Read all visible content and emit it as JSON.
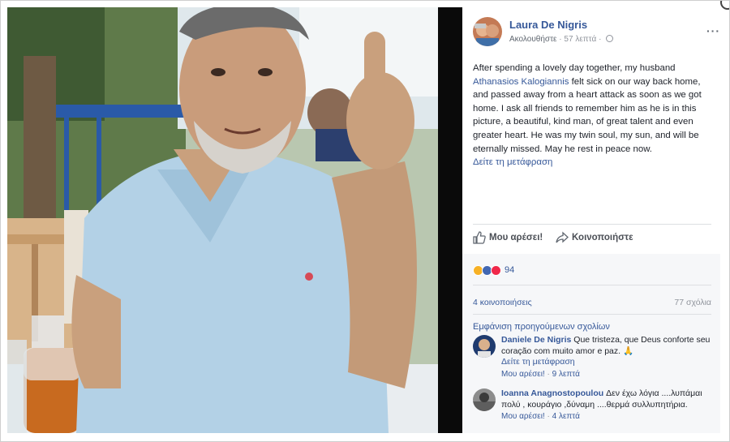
{
  "post": {
    "author": "Laura De Nigris",
    "follow_label": "Ακολουθήστε",
    "dot": "·",
    "time": "57 λεπτά",
    "more_label": "···",
    "text_before": "After spending a lovely day together, my husband",
    "mention": "Athanasios Kalogiannis",
    "text_after": "felt sick on our way back home, and passed away from a heart attack as soon as we got home. I ask all friends to remember him as he is in this picture, a beautiful, kind man, of great talent and even greater heart. He was my twin soul, my sun, and will be eternally missed. May he rest in peace now.",
    "see_translation": "Δείτε τη μετάφραση"
  },
  "actions": {
    "like": "Μου αρέσει!",
    "share": "Κοινοποιήστε"
  },
  "reactions": {
    "count": "94",
    "icons": [
      "sad-reaction-icon",
      "like-reaction-icon",
      "love-reaction-icon"
    ]
  },
  "stats": {
    "shares": "4 κοινοποιήσεις",
    "comments": "77 σχόλια"
  },
  "previous_comments": "Εμφάνιση προηγούμενων σχολίων",
  "comments": [
    {
      "name": "Daniele De Nigris",
      "text": "Que tristeza, que Deus conforte seu coração com muito amor e paz. 🙏",
      "translate": "Δείτε τη μετάφραση",
      "like": "Μου αρέσει!",
      "time": "9 λεπτά"
    },
    {
      "name": "Ioanna Anagnostopoulou",
      "text": "Δεν έχω λόγια ....λυπάμαι πολύ , κουράγιο ,δύναμη ....θερμά συλλυπητήρια.",
      "like": "Μου αρέσει!",
      "time": "4 λεπτά"
    }
  ],
  "colors": {
    "link": "#365899",
    "muted": "#90949c",
    "panel": "#f6f7f9",
    "like_blue": "#4267b2",
    "love_red": "#f0284a",
    "sad_yellow": "#f7b125"
  }
}
